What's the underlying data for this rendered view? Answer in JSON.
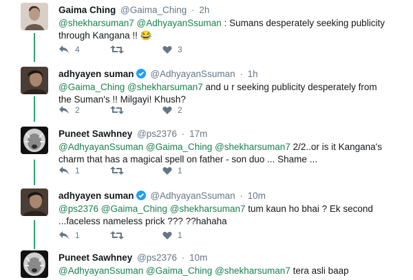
{
  "tweets": [
    {
      "name": "Gaima Ching",
      "verified": false,
      "handle": "@Gaima_Ching",
      "time": "2h",
      "mentions": [
        "@shekharsuman7",
        "@AdhyayanSsuman"
      ],
      "text_1": " : Sumans desperately seeking publicity",
      "text_2": "through Kangana !! 😂",
      "reply_count": "4",
      "retweet_count": "",
      "like_count": "3"
    },
    {
      "name": "adhyayen suman",
      "verified": true,
      "handle": "@AdhyayanSsuman",
      "time": "1h",
      "mentions": [
        "@Gaima_Ching",
        "@shekharsuman7"
      ],
      "text_1": " and u r seeking publicity desperately from",
      "text_2": "the Suman's !! Milgayi! Khush?",
      "reply_count": "2",
      "retweet_count": "",
      "like_count": "2"
    },
    {
      "name": "Puneet Sawhney",
      "verified": false,
      "handle": "@ps2376",
      "time": "17m",
      "mentions": [
        "@AdhyayanSsuman",
        "@Gaima_Ching",
        "@shekharsuman7"
      ],
      "text_1": "  2/2..or is it Kangana's",
      "text_2": "charm that has a magical spell on father - son duo ... Shame ...",
      "reply_count": "1",
      "retweet_count": "",
      "like_count": "1"
    },
    {
      "name": "adhyayen suman",
      "verified": true,
      "handle": "@AdhyayanSsuman",
      "time": "10m",
      "mentions": [
        "@ps2376",
        "@Gaima_Ching",
        "@shekharsuman7"
      ],
      "text_1": " tum kaun ho bhai ? Ek second",
      "text_2": "...faceless nameless prick ??? ??hahaha",
      "reply_count": "1",
      "retweet_count": "",
      "like_count": "1"
    },
    {
      "name": "Puneet Sawhney",
      "verified": false,
      "handle": "@ps2376",
      "time": "10m",
      "mentions": [
        "@AdhyayanSsuman",
        "@Gaima_Ching",
        "@shekharsuman7"
      ],
      "text_1": " tera asli baap",
      "text_2": ""
    }
  ],
  "separator": "·",
  "colors": {
    "mention": "#1b7f4f",
    "thread_line": "#2ea36a",
    "muted": "#657786",
    "verified": "#1da1f2"
  },
  "icons": {
    "reply": "reply-icon",
    "retweet": "retweet-icon",
    "like": "heart-icon",
    "verified": "verified-badge-icon"
  }
}
